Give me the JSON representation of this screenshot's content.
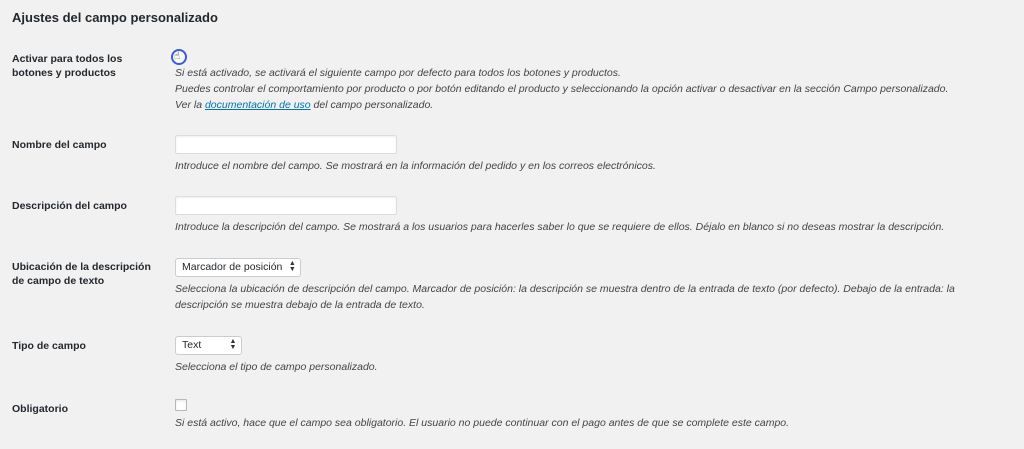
{
  "section_title": "Ajustes del campo personalizado",
  "rows": {
    "activate": {
      "label": "Activar para todos los botones y productos",
      "desc_line1": "Si está activado, se activará el siguiente campo por defecto para todos los botones y productos.",
      "desc_line2": "Puedes controlar el comportamiento por producto o por botón editando el producto y seleccionando la opción activar o desactivar en la sección Campo personalizado.",
      "desc_line3_prefix": "Ver la ",
      "desc_line3_link": "documentación de uso",
      "desc_line3_suffix": " del campo personalizado."
    },
    "field_name": {
      "label": "Nombre del campo",
      "value": "",
      "desc": "Introduce el nombre del campo. Se mostrará en la información del pedido y en los correos electrónicos."
    },
    "field_description": {
      "label": "Descripción del campo",
      "value": "",
      "desc": "Introduce la descripción del campo. Se mostrará a los usuarios para hacerles saber lo que se requiere de ellos. Déjalo en blanco si no deseas mostrar la descripción."
    },
    "description_location": {
      "label": "Ubicación de la descripción de campo de texto",
      "selected": "Marcador de posición",
      "desc": "Selecciona la ubicación de descripción del campo. Marcador de posición: la descripción se muestra dentro de la entrada de texto (por defecto). Debajo de la entrada: la descripción se muestra debajo de la entrada de texto."
    },
    "field_type": {
      "label": "Tipo de campo",
      "selected": "Text",
      "desc": "Selecciona el tipo de campo personalizado."
    },
    "required": {
      "label": "Obligatorio",
      "checked": false,
      "desc": "Si está activo, hace que el campo sea obligatorio. El usuario no puede continuar con el pago antes de que se complete este campo."
    }
  },
  "icons": {
    "select_arrows": "up-down-arrows-icon",
    "cursor": "hand-pointer-icon"
  },
  "colors": {
    "background": "#f1f1f1",
    "link": "#0073aa",
    "cursor_ring": "#3b5bd9"
  }
}
